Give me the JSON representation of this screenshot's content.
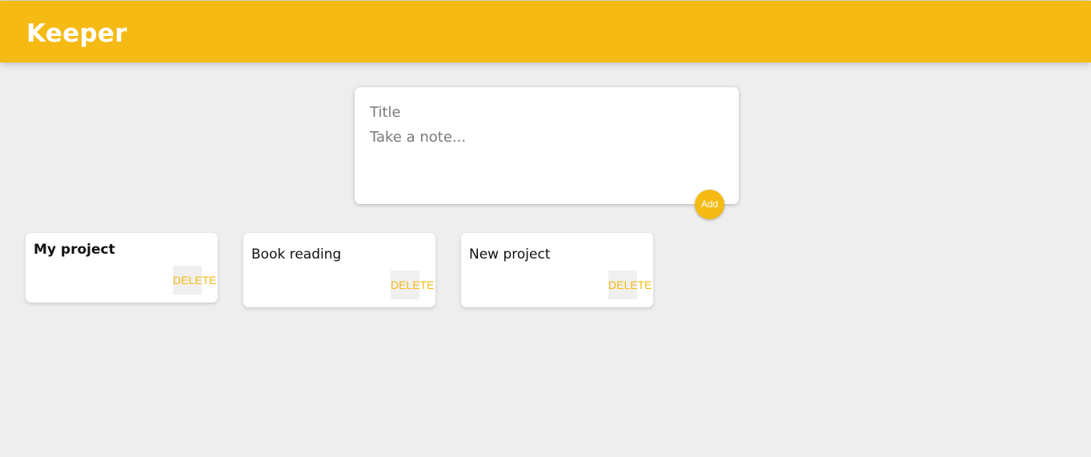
{
  "header": {
    "title": "Keeper"
  },
  "create_area": {
    "title_placeholder": "Title",
    "content_placeholder": "Take a note...",
    "add_label": "Add"
  },
  "notes": [
    {
      "title": "My project",
      "delete_label": "DELETE"
    },
    {
      "title": "Book reading",
      "delete_label": "DELETE"
    },
    {
      "title": "New project",
      "delete_label": "DELETE"
    }
  ],
  "colors": {
    "accent": "#f5ba13",
    "background": "#eeeeee",
    "card": "#ffffff"
  }
}
